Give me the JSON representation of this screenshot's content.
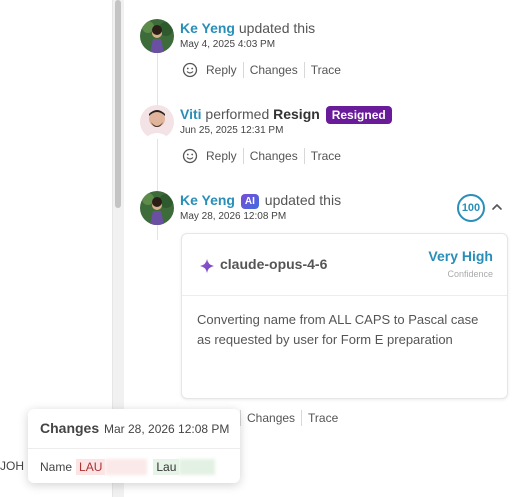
{
  "entries": [
    {
      "actor": "Ke Yeng",
      "verb": "updated this",
      "timestamp": "May 4, 2025 4:03 PM",
      "actions": [
        "Reply",
        "Changes",
        "Trace"
      ]
    },
    {
      "actor": "Viti",
      "verb": "performed",
      "action_name": "Resign",
      "badge": "Resigned",
      "timestamp": "Jun 25, 2025 12:31 PM",
      "actions": [
        "Reply",
        "Changes",
        "Trace"
      ]
    },
    {
      "actor": "Ke Yeng",
      "ai_badge": "AI",
      "verb": "updated this",
      "timestamp": "May 28, 2026 12:08 PM",
      "score": "100",
      "actions": [
        "Changes",
        "Trace"
      ]
    }
  ],
  "ai_card": {
    "model": "claude-opus-4-6",
    "confidence_value": "Very High",
    "confidence_label": "Confidence",
    "reason": "Converting name from ALL CAPS to Pascal case as requested by user for Form E preparation"
  },
  "changes_popover": {
    "title": "Changes",
    "date": "Mar 28, 2026 12:08 PM",
    "field": "Name",
    "old_value": "LAU",
    "new_value": "Lau"
  },
  "left_edge_text": "JOH",
  "icons": {
    "reply_emoji": "smile-icon",
    "sparkle": "sparkle-icon",
    "chevron": "chevron-up-icon"
  },
  "colors": {
    "accent": "#2a8fb8",
    "resigned_badge": "#6a1b9a"
  }
}
